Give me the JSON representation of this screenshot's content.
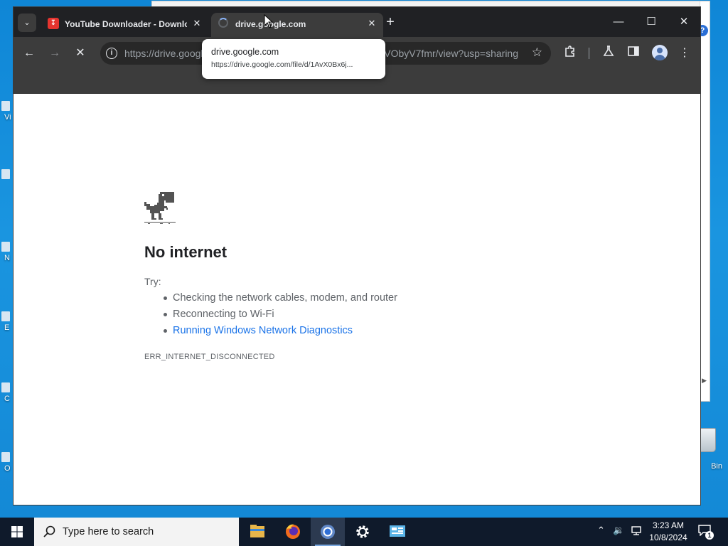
{
  "desktop": {
    "icons": [
      {
        "label": "Vi"
      },
      {
        "label": ""
      },
      {
        "label": "N"
      },
      {
        "label": "E"
      },
      {
        "label": "C"
      },
      {
        "label": "O"
      }
    ],
    "recycle_bin_label": "Bin"
  },
  "browser": {
    "tabs": [
      {
        "title": "YouTube Downloader - Downlo",
        "favicon": "download-icon",
        "active": false
      },
      {
        "title": "drive.google.com",
        "favicon": "loading-spinner-icon",
        "active": true
      }
    ],
    "address_bar": {
      "url_start": "https://drive.googl",
      "url_end": "VObyV7fmr/view?usp=sharing"
    },
    "hover_card": {
      "title": "drive.google.com",
      "url": "https://drive.google.com/file/d/1AvX0Bx6j..."
    }
  },
  "error_page": {
    "title": "No internet",
    "try_label": "Try:",
    "suggestions": [
      "Checking the network cables, modem, and router",
      "Reconnecting to Wi-Fi"
    ],
    "diagnostics_link": "Running Windows Network Diagnostics",
    "error_code": "ERR_INTERNET_DISCONNECTED"
  },
  "taskbar": {
    "search_placeholder": "Type here to search",
    "apps": [
      "file-explorer-icon",
      "firefox-icon",
      "chrome-icon",
      "settings-icon",
      "control-panel-icon"
    ],
    "clock": {
      "time": "3:23 AM",
      "date": "10/8/2024"
    },
    "notification_count": "1"
  }
}
